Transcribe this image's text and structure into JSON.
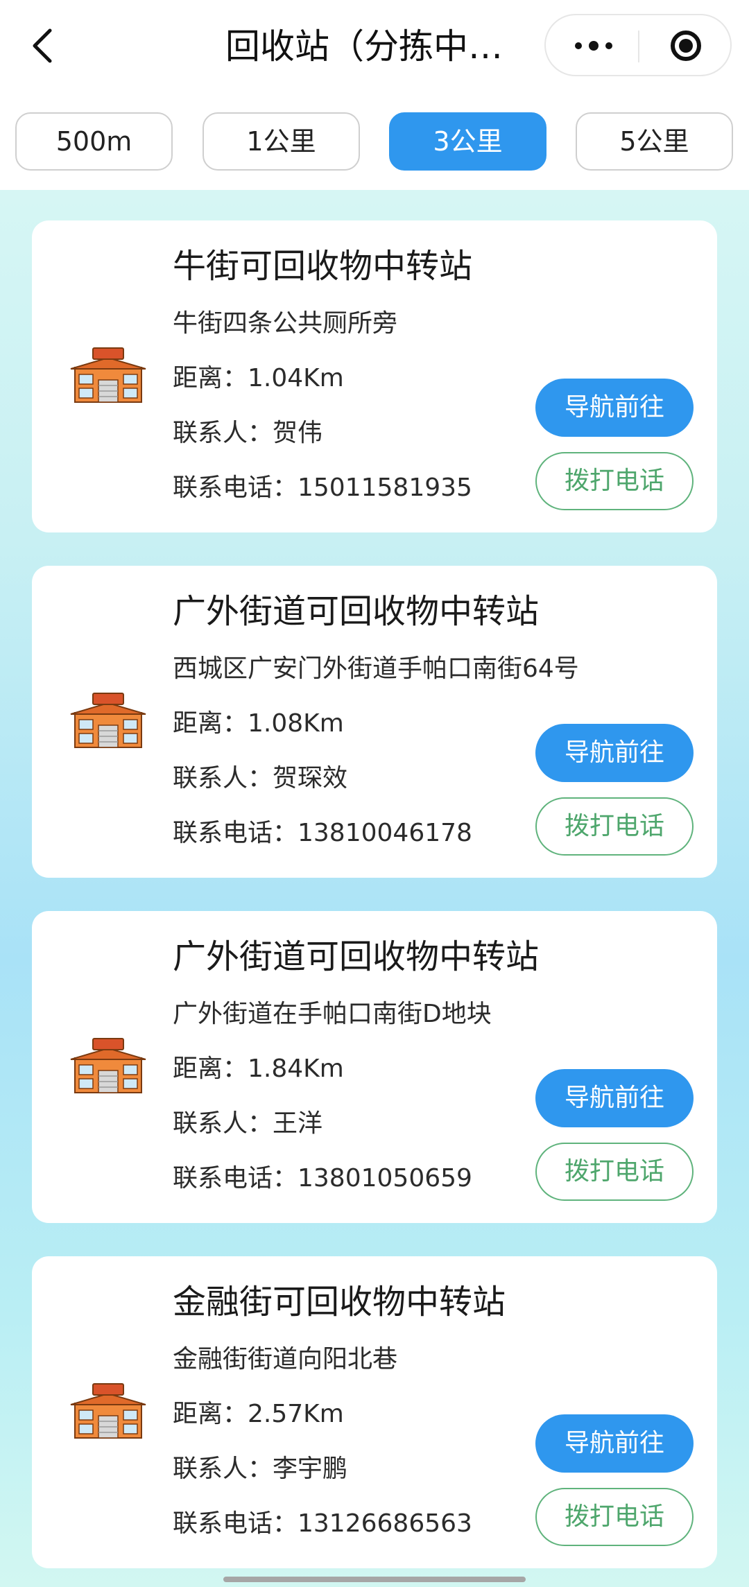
{
  "nav": {
    "title": "回收站（分拣中…"
  },
  "tabs": [
    {
      "label": "500m",
      "active": false
    },
    {
      "label": "1公里",
      "active": false
    },
    {
      "label": "3公里",
      "active": true
    },
    {
      "label": "5公里",
      "active": false
    }
  ],
  "labels": {
    "distance_prefix": "距离：",
    "contact_prefix": "联系人：",
    "phone_prefix": "联系电话：",
    "navigate_button": "导航前往",
    "call_button": "拨打电话",
    "icon_sign": "回收中心"
  },
  "stations": [
    {
      "name": "牛街可回收物中转站",
      "address": "牛街四条公共厕所旁",
      "distance": "距离：1.04Km",
      "contact": "联系人：贺伟",
      "phone": "联系电话：15011581935"
    },
    {
      "name": "广外街道可回收物中转站",
      "address": "西城区广安门外街道手帕口南街64号",
      "distance": "距离：1.08Km",
      "contact": "联系人：贺琛效",
      "phone": "联系电话：13810046178"
    },
    {
      "name": "广外街道可回收物中转站",
      "address": "广外街道在手帕口南街D地块",
      "distance": "距离：1.84Km",
      "contact": "联系人：王洋",
      "phone": "联系电话：13801050659"
    },
    {
      "name": "金融街可回收物中转站",
      "address": "金融街街道向阳北巷",
      "distance": "距离：2.57Km",
      "contact": "联系人：李宇鹏",
      "phone": "联系电话：13126686563"
    }
  ],
  "colors": {
    "accent": "#2f97ee",
    "call_green": "#4ea66c",
    "icon_orange": "#f08a3c"
  }
}
